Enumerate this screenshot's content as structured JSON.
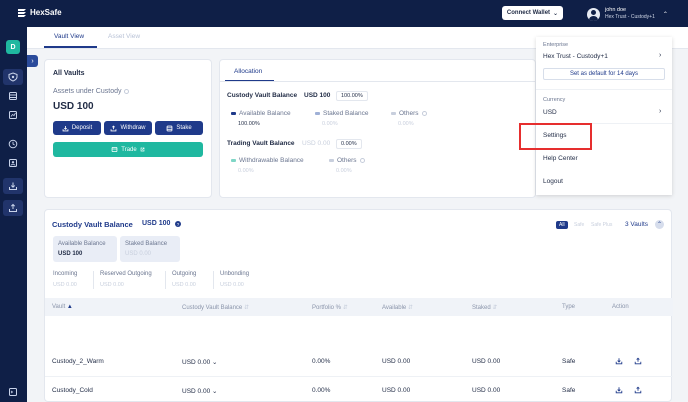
{
  "app": {
    "logo_text": "HexSafe"
  },
  "header": {
    "connect_wallet": "Connect Wallet",
    "user_name": "john doe",
    "user_org": "Hex Trust - Custody+1"
  },
  "tabs": [
    {
      "label": "Vault View",
      "active": true
    },
    {
      "label": "Asset View",
      "active": false
    }
  ],
  "sidebar": {
    "badge": "D"
  },
  "all_vaults": {
    "title": "All Vaults",
    "assets_label": "Assets under Custody",
    "assets_value": "USD 100",
    "deposit": "Deposit",
    "withdraw": "Withdraw",
    "stake": "Stake",
    "trade": "Trade"
  },
  "allocation": {
    "tab": "Allocation",
    "custody": {
      "title": "Custody Vault Balance",
      "amount": "USD 100",
      "pct": "100.00%",
      "legend": [
        {
          "label": "Available Balance",
          "value": "100.00%",
          "color": "#1f3a8a",
          "faded": false
        },
        {
          "label": "Staked Balance",
          "value": "0.00%",
          "color": "#9fb0d6",
          "faded": true
        },
        {
          "label": "Others",
          "value": "0.00%",
          "color": "#c8cfdd",
          "faded": true
        }
      ]
    },
    "trading": {
      "title": "Trading Vault Balance",
      "amount": "USD 0.00",
      "pct": "0.00%",
      "legend": [
        {
          "label": "Withdrawable Balance",
          "value": "0.00%",
          "color": "#7fd6c6",
          "faded": true
        },
        {
          "label": "Others",
          "value": "0.00%",
          "color": "#c8cfdd",
          "faded": true
        }
      ]
    }
  },
  "menu": {
    "enterprise_label": "Enterprise",
    "enterprise_value": "Hex Trust - Custody+1",
    "set_default": "Set as default for 14 days",
    "currency_label": "Currency",
    "currency_value": "USD",
    "settings": "Settings",
    "help_center": "Help Center",
    "logout": "Logout"
  },
  "custody_vault": {
    "title": "Custody Vault Balance",
    "amount": "USD 100",
    "filters": [
      "All",
      "Safe",
      "Safe Plus"
    ],
    "vault_count": "3 Vaults",
    "available_label": "Available Balance",
    "available_value": "USD 100",
    "staked_label": "Staked Balance",
    "staked_value": "USD 0.00",
    "stats": [
      {
        "label": "Incoming",
        "value": "USD 0.00"
      },
      {
        "label": "Reserved Outgoing",
        "value": "USD 0.00"
      },
      {
        "label": "Outgoing",
        "value": "USD 0.00"
      },
      {
        "label": "Unbonding",
        "value": "USD 0.00"
      }
    ],
    "columns": [
      "Vault",
      "Custody Vault Balance",
      "Portfolio %",
      "Available",
      "Staked",
      "Type",
      "Action"
    ],
    "rows": [
      {
        "vault": "Custody_2_Warm",
        "balance": "USD 0.00",
        "portfolio": "0.00%",
        "available": "USD 0.00",
        "staked": "USD 0.00",
        "type": "Safe"
      },
      {
        "vault": "Custody_Cold",
        "balance": "USD 0.00",
        "portfolio": "0.00%",
        "available": "USD 0.00",
        "staked": "USD 0.00",
        "type": "Safe"
      }
    ]
  }
}
